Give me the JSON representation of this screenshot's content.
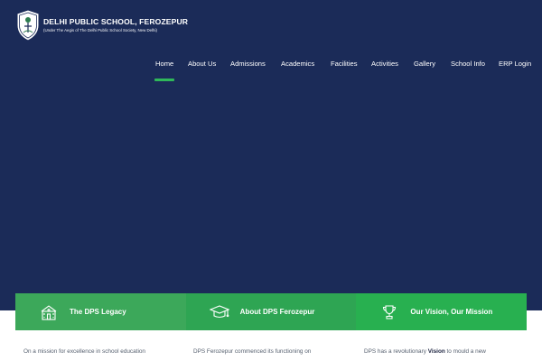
{
  "header": {
    "school_name": "DELHI PUBLIC SCHOOL, FEROZEPUR",
    "school_sub": "(Under The Aegis of The Delhi Public School Society, New Delhi)",
    "logo_icon": "school-crest-icon"
  },
  "nav": {
    "items": [
      {
        "label": "Home",
        "active": true
      },
      {
        "label": "About Us"
      },
      {
        "label": "Admissions"
      },
      {
        "label": "Academics"
      },
      {
        "label": "Facilities"
      },
      {
        "label": "Activities"
      },
      {
        "label": "Gallery"
      },
      {
        "label": "School Info"
      },
      {
        "label": "ERP Login"
      }
    ]
  },
  "cards": [
    {
      "label": "The DPS Legacy",
      "icon": "school-building-icon"
    },
    {
      "label": "About DPS Ferozepur",
      "icon": "graduation-cap-icon"
    },
    {
      "label": "Our Vision, Our Mission",
      "icon": "trophy-icon"
    }
  ],
  "columns": {
    "col1_text": "On a mission for excellence in school education",
    "col2_text": "DPS Ferozepur commenced its functioning on",
    "col3_pre": "DPS has a revolutionary ",
    "col3_bold": "Vision",
    "col3_post": " to mould a new"
  },
  "colors": {
    "hero_bg": "#1b2b58",
    "accent_green": "#2fb85a",
    "card_green": "#2ea553"
  }
}
